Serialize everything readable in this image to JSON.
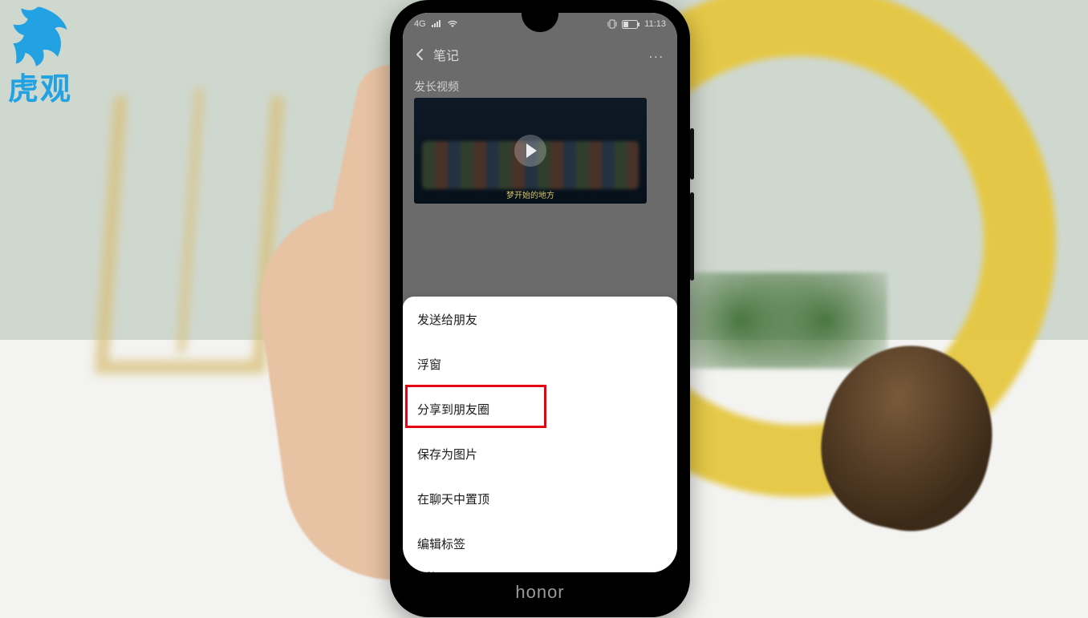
{
  "watermark": {
    "text": "虎观"
  },
  "phone": {
    "brand": "honor"
  },
  "status": {
    "network": "4G",
    "time": "11:13"
  },
  "nav": {
    "title": "笔记",
    "back_icon": "back-icon",
    "more_icon": "more-icon",
    "more_glyph": "..."
  },
  "note": {
    "title": "发长视频",
    "video_caption": "梦开始的地方"
  },
  "sheet": {
    "items": [
      "发送给朋友",
      "浮窗",
      "分享到朋友圈",
      "保存为图片",
      "在聊天中置顶",
      "编辑标签"
    ],
    "partial": "删除"
  },
  "highlight_index": 2
}
